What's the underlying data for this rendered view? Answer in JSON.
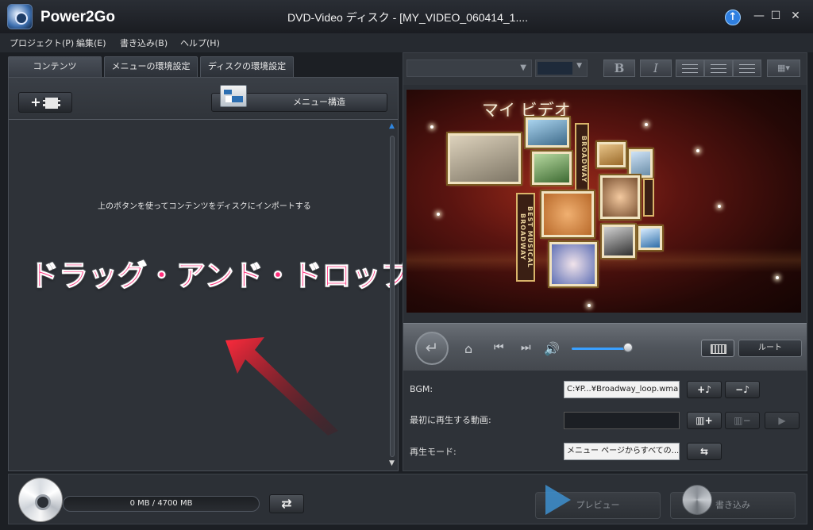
{
  "app": {
    "name": "Power2Go",
    "window_title": "DVD-Video ディスク - [MY_VIDEO_060414_1....",
    "window_controls": [
      "upgrade-icon",
      "minimize-icon",
      "maximize-icon",
      "close-icon"
    ]
  },
  "menu": {
    "items": [
      "プロジェクト(P)",
      "編集(E)",
      "書き込み(B)",
      "ヘルプ(H)"
    ]
  },
  "left": {
    "tabs": [
      "コンテンツ",
      "メニューの環境設定",
      "ディスクの環境設定"
    ],
    "add_button_label": "+",
    "menu_structure_label": "メニュー構造",
    "hint": "上のボタンを使ってコンテンツをディスクにインポートする",
    "drag_drop_text": "ドラッグ・アンド・ドロップ"
  },
  "format": {
    "bold": "B",
    "italic": "I"
  },
  "preview": {
    "menu_title": "マイ ビデオ",
    "marquee_text": "BROADWAY",
    "marquee_small": "BEST MUSICAL BROADWAY",
    "background_color": "#5a1410"
  },
  "transport": {
    "root_label": "ルート",
    "volume_level": 0.95
  },
  "settings": {
    "bgm_label": "BGM:",
    "bgm_value": "C:¥P...¥Broadway_loop.wma",
    "first_play_label": "最初に再生する動画:",
    "first_play_value": "",
    "playback_mode_label": "再生モード:",
    "playback_mode_value": "メニュー ページからすべての...",
    "add_music_label": "+♪",
    "remove_music_label": "−♪"
  },
  "bottom": {
    "capacity_text": "0 MB / 4700 MB",
    "preview_label": "プレビュー",
    "burn_label": "書き込み"
  },
  "colors": {
    "accent": "#2f86e0",
    "drag_text": "#ff2d7a",
    "arrow": "#d0142a"
  }
}
